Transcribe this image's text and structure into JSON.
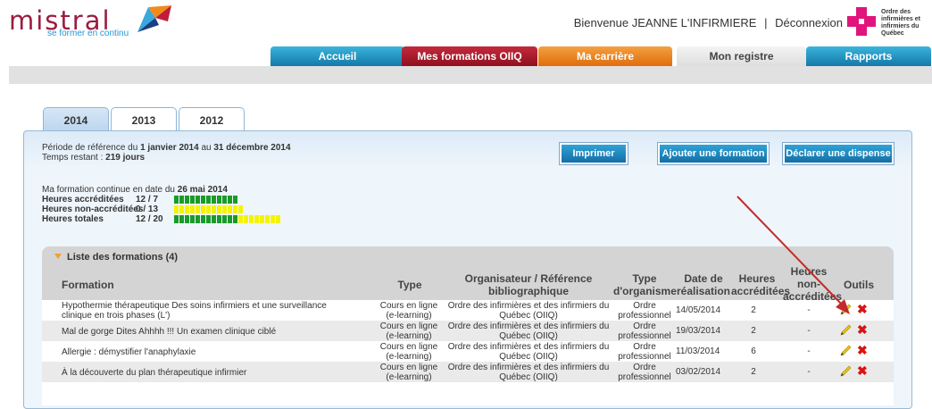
{
  "header": {
    "logo_word": "mistral",
    "logo_tagline": "se former en continu",
    "welcome_text": "Bienvenue JEANNE L'INFIRMIERE",
    "separator": "|",
    "logout_label": "Déconnexion",
    "org_logo_text": "Ordre des infirmières et infirmiers du Québec"
  },
  "nav": {
    "tabs": [
      {
        "label": "Accueil",
        "color": "#1d88bd"
      },
      {
        "label": "Mes formations OIIQ",
        "color": "#a8192b"
      },
      {
        "label": "Ma carrière",
        "color": "#ea7c1c"
      },
      {
        "label": "Mon registre",
        "color": "#e6e6e6"
      },
      {
        "label": "Rapports",
        "color": "#1d88bd"
      }
    ]
  },
  "years": {
    "tabs": [
      "2014",
      "2013",
      "2012"
    ],
    "active": "2014"
  },
  "period": {
    "prefix": "Période de référence du",
    "start": "1 janvier 2014",
    "middle": "au",
    "end": "31 décembre 2014",
    "remaining_prefix": "Temps restant :",
    "remaining": "219 jours"
  },
  "actions": {
    "print": "Imprimer",
    "add": "Ajouter une formation",
    "exempt": "Déclarer une dispense"
  },
  "status": {
    "date_prefix": "Ma formation continue en date du",
    "date": "26 mai 2014",
    "rows": [
      {
        "label": "Heures accréditées",
        "value": "12 / 7",
        "filled": 12,
        "total": 12
      },
      {
        "label": "Heures non-accréditées",
        "value": "0 / 13",
        "filled": 0,
        "total": 13
      },
      {
        "label": "Heures totales",
        "value": "12 / 20",
        "filled": 12,
        "total": 20
      }
    ]
  },
  "list": {
    "title": "Liste des formations (4)",
    "columns": [
      "Formation",
      "Type",
      "Organisateur / Référence bibliographique",
      "Type d'organisme",
      "Date de réalisation",
      "Heures accréditées",
      "Heures non-accréditées",
      "Outils"
    ],
    "rows": [
      {
        "formation": "Hypothermie thérapeutique Des soins infirmiers et une surveillance clinique en trois phases (L')",
        "type": "Cours en ligne (e-learning)",
        "org": "Ordre des infirmières et des infirmiers du Québec (OIIQ)",
        "org_type": "Ordre professionnel",
        "date": "14/05/2014",
        "hours": "2",
        "non_hours": "-"
      },
      {
        "formation": "Mal de gorge Dites Ahhhh !!! Un examen clinique ciblé",
        "type": "Cours en ligne (e-learning)",
        "org": "Ordre des infirmières et des infirmiers du Québec (OIIQ)",
        "org_type": "Ordre professionnel",
        "date": "19/03/2014",
        "hours": "2",
        "non_hours": "-"
      },
      {
        "formation": "Allergie : démystifier l'anaphylaxie",
        "type": "Cours en ligne (e-learning)",
        "org": "Ordre des infirmières et des infirmiers du Québec (OIIQ)",
        "org_type": "Ordre professionnel",
        "date": "11/03/2014",
        "hours": "6",
        "non_hours": "-"
      },
      {
        "formation": "À la découverte du plan thérapeutique infirmier",
        "type": "Cours en ligne (e-learning)",
        "org": "Ordre des infirmières et des infirmiers du Québec (OIIQ)",
        "org_type": "Ordre professionnel",
        "date": "03/02/2014",
        "hours": "2",
        "non_hours": "-"
      }
    ]
  },
  "icons": {
    "edit": "pencil-icon",
    "delete": "delete-x-icon"
  },
  "colors": {
    "accent_blue": "#1d88bd",
    "bar_green": "#1b9a2a",
    "bar_yellow": "#f4f400",
    "annotation_arrow": "#c42a2a"
  }
}
